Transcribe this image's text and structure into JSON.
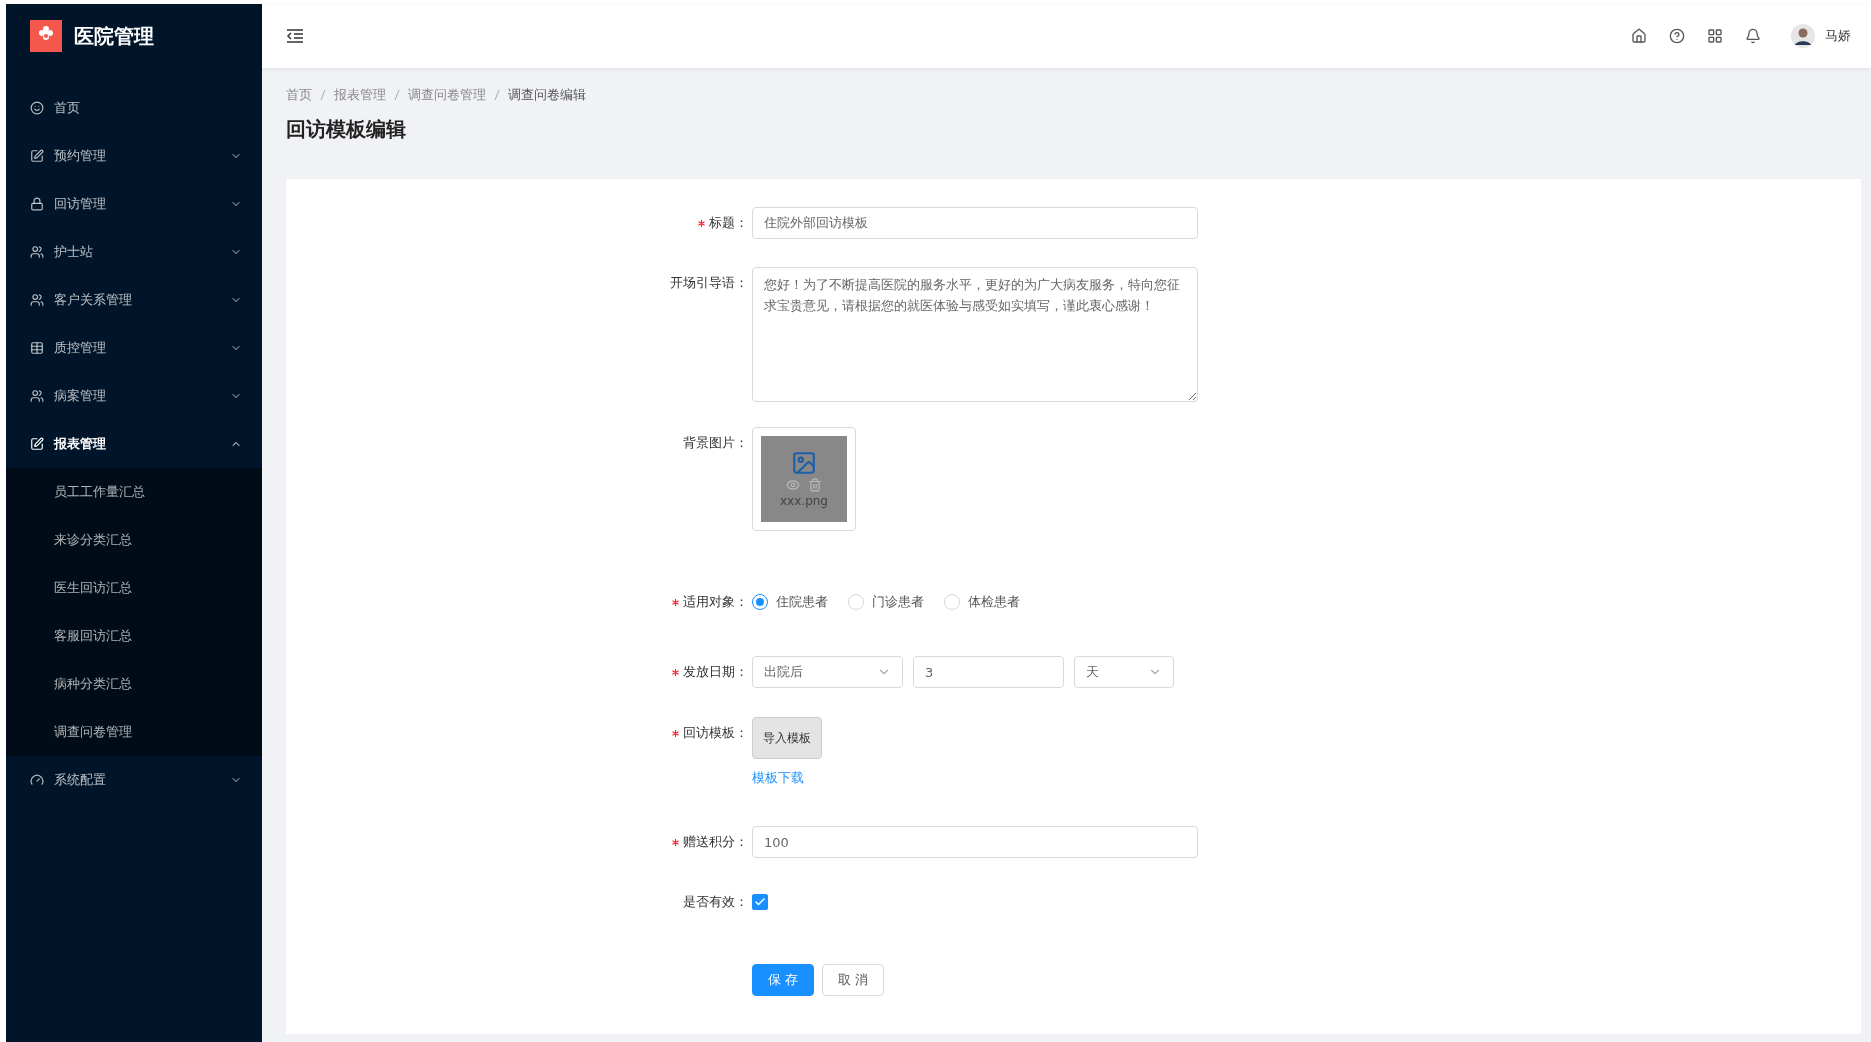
{
  "app": {
    "title": "医院管理"
  },
  "sidebar": {
    "items": [
      {
        "label": "首页",
        "selected": false
      },
      {
        "label": "预约管理",
        "selected": false,
        "expanded": false
      },
      {
        "label": "回访管理",
        "selected": false,
        "expanded": false
      },
      {
        "label": "护士站",
        "selected": false,
        "expanded": false
      },
      {
        "label": "客户关系管理",
        "selected": false,
        "expanded": false
      },
      {
        "label": "质控管理",
        "selected": false,
        "expanded": false
      },
      {
        "label": "病案管理",
        "selected": false,
        "expanded": false
      },
      {
        "label": "报表管理",
        "selected": true,
        "expanded": true,
        "children": [
          {
            "label": "员工工作量汇总",
            "selected": false
          },
          {
            "label": "来诊分类汇总",
            "selected": false
          },
          {
            "label": "医生回访汇总",
            "selected": false
          },
          {
            "label": "客服回访汇总",
            "selected": false
          },
          {
            "label": "病种分类汇总",
            "selected": false
          },
          {
            "label": "调查问卷管理",
            "selected": false
          }
        ]
      },
      {
        "label": "系统配置",
        "selected": false,
        "expanded": false
      }
    ]
  },
  "header": {
    "user": "马娇"
  },
  "breadcrumb": [
    "首页",
    "报表管理",
    "调查问卷管理",
    "调查问卷编辑"
  ],
  "page_title": "回访模板编辑",
  "form": {
    "fields": [
      {
        "kind": "text",
        "label": "标题：",
        "required": true,
        "value": "住院外部回访模板"
      },
      {
        "kind": "textarea",
        "label": "开场引导语：",
        "required": false,
        "value": "您好！为了不断提高医院的服务水平，更好的为广大病友服务，特向您征求宝贵意见，请根据您的就医体验与感受如实填写，谨此衷心感谢！"
      },
      {
        "kind": "image",
        "label": "背景图片：",
        "required": false,
        "filename": "xxx.png"
      },
      {
        "kind": "radio",
        "label": "适用对象：",
        "required": true,
        "options": [
          {
            "label": "住院患者",
            "selected": true
          },
          {
            "label": "门诊患者",
            "selected": false
          },
          {
            "label": "体检患者",
            "selected": false
          }
        ]
      },
      {
        "kind": "date",
        "label": "发放日期：",
        "required": true,
        "event": "出院后",
        "amount": "3",
        "unit": "天"
      },
      {
        "kind": "upload",
        "label": "回访模板：",
        "required": true,
        "button": "导入模板",
        "link": "模板下载"
      },
      {
        "kind": "text",
        "label": "赠送积分：",
        "required": true,
        "value": "100"
      },
      {
        "kind": "checkbox",
        "label": "是否有效：",
        "required": false,
        "checked": true
      }
    ],
    "buttons": [
      {
        "label": "保 存",
        "kind": "primary"
      },
      {
        "label": "取 消",
        "kind": "default"
      }
    ]
  }
}
